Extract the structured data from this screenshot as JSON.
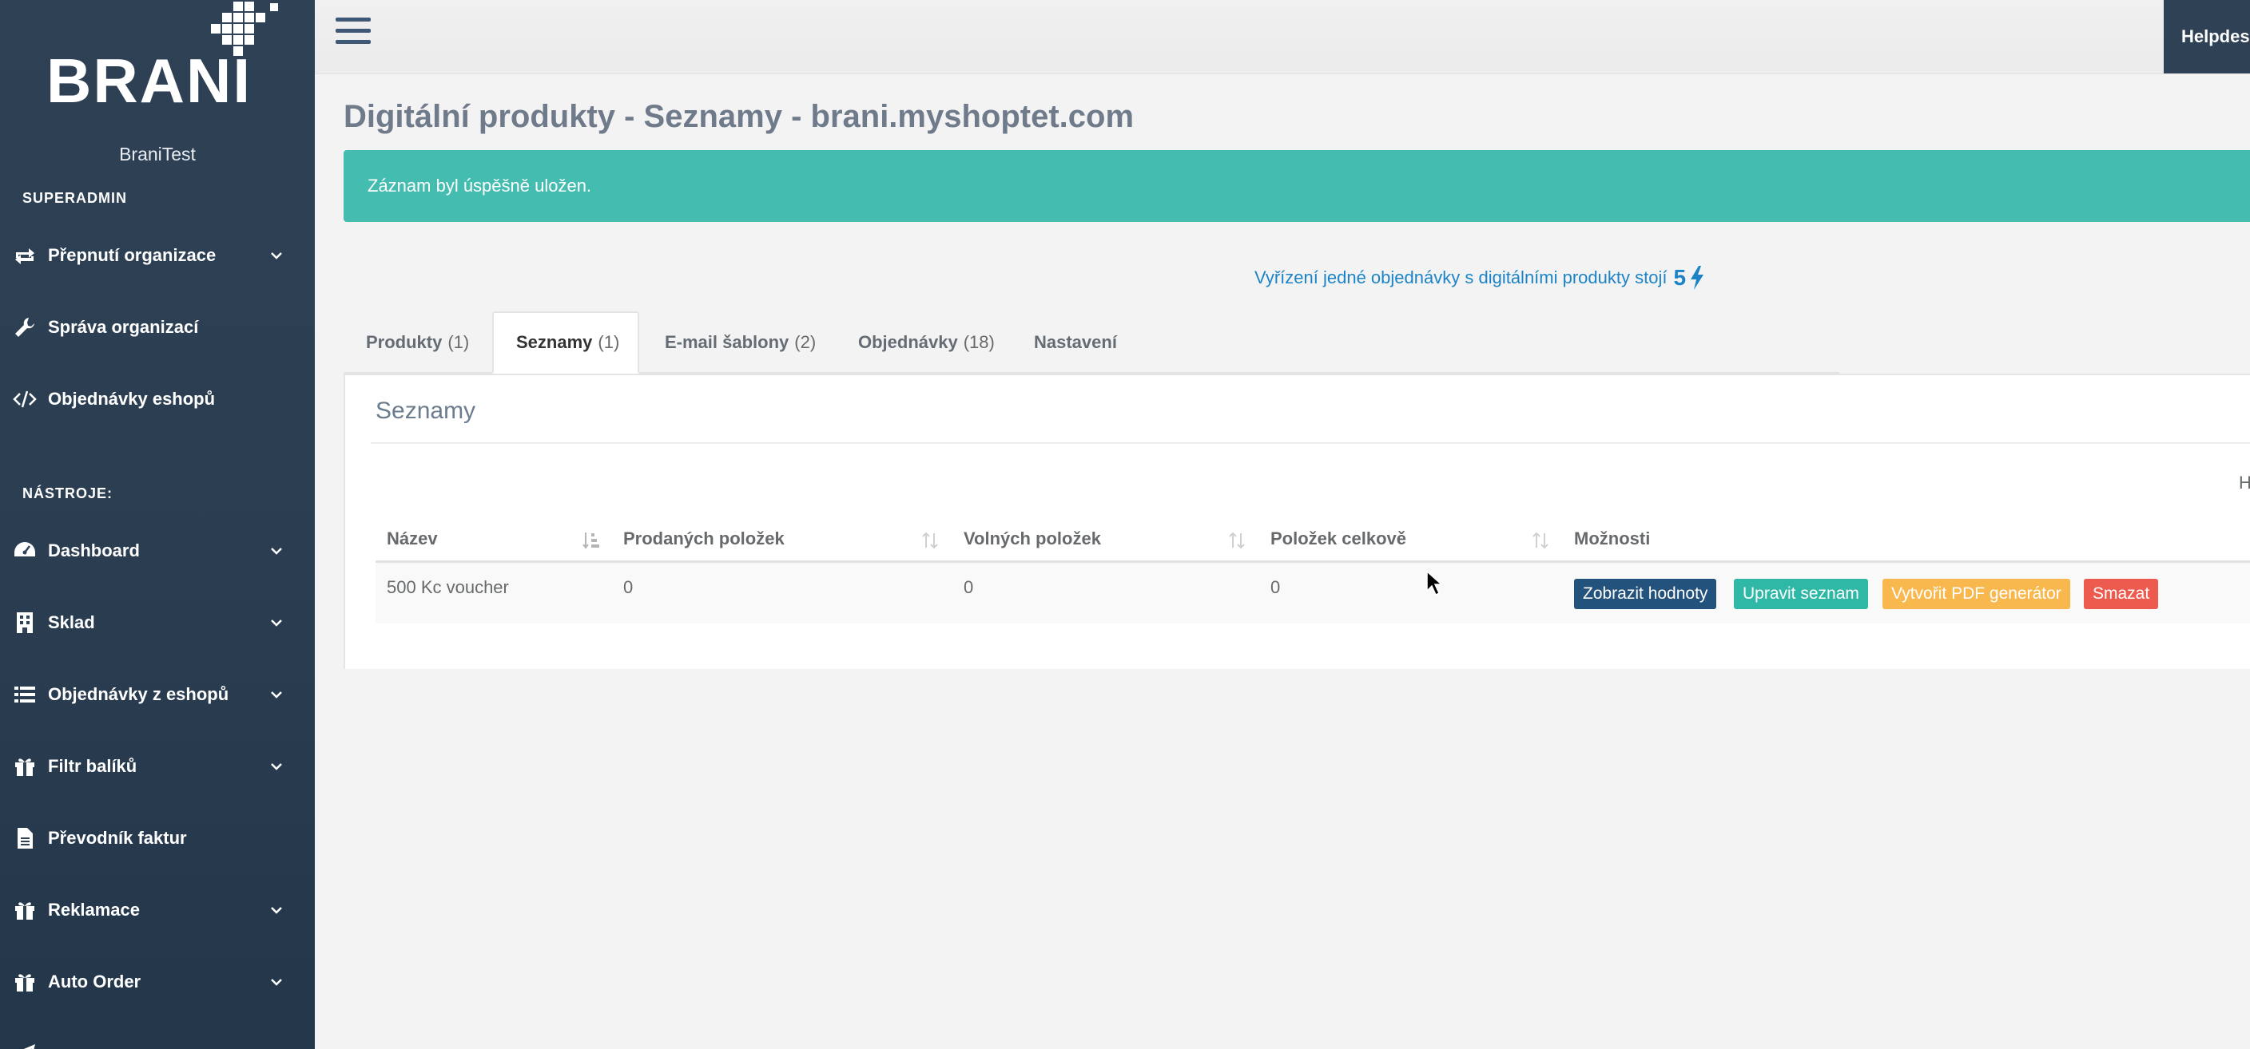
{
  "sidebar": {
    "logo_text": "BRANI",
    "org_name": "BraniTest",
    "section_superadmin": "SUPERADMIN",
    "section_tools": "NÁSTROJE:",
    "items": [
      {
        "label": "Přepnutí organizace",
        "icon": "exchange-icon",
        "chevron": true
      },
      {
        "label": "Správa organizací",
        "icon": "wrench-icon",
        "chevron": false
      },
      {
        "label": "Objednávky eshopů",
        "icon": "code-icon",
        "chevron": false
      },
      {
        "label": "Dashboard",
        "icon": "dashboard-icon",
        "chevron": true
      },
      {
        "label": "Sklad",
        "icon": "building-icon",
        "chevron": true
      },
      {
        "label": "Objednávky z eshopů",
        "icon": "list-icon",
        "chevron": true
      },
      {
        "label": "Filtr balíků",
        "icon": "gift-icon",
        "chevron": true
      },
      {
        "label": "Převodník faktur",
        "icon": "file-icon",
        "chevron": false
      },
      {
        "label": "Reklamace",
        "icon": "gift-icon",
        "chevron": true
      },
      {
        "label": "Auto Order",
        "icon": "gift-icon",
        "chevron": true
      }
    ]
  },
  "topbar": {
    "helpdesk_label": "Helpdes"
  },
  "page": {
    "title": "Digitální produkty - Seznamy - brani.myshoptet.com",
    "alert_text": "Záznam byl úspěšně uložen.",
    "price_note": "Vyřízení jedné objednávky s digitálními produkty stojí",
    "price_value": "5"
  },
  "tabs": [
    {
      "label": "Produkty",
      "count": "(1)",
      "active": false
    },
    {
      "label": "Seznamy",
      "count": "(1)",
      "active": true
    },
    {
      "label": "E-mail šablony",
      "count": "(2)",
      "active": false
    },
    {
      "label": "Objednávky",
      "count": "(18)",
      "active": false
    },
    {
      "label": "Nastavení",
      "count": "",
      "active": false
    }
  ],
  "panel": {
    "title": "Seznamy",
    "right_fragment": "H"
  },
  "table": {
    "headers": [
      "Název",
      "Prodaných položek",
      "Volných položek",
      "Položek celkově",
      "Možnosti"
    ],
    "rows": [
      {
        "name": "500 Kc voucher",
        "sold": "0",
        "free": "0",
        "total": "0"
      }
    ],
    "actions": {
      "show": "Zobrazit hodnoty",
      "edit": "Upravit seznam",
      "pdf": "Vytvořit PDF generátor",
      "delete": "Smazat"
    }
  },
  "colors": {
    "sidebar": "#2f4155",
    "alert": "#44bcb0",
    "btn_show": "#23527c",
    "btn_edit": "#2fb8a6",
    "btn_pdf": "#f8b84e",
    "btn_delete": "#ed5a4e"
  }
}
